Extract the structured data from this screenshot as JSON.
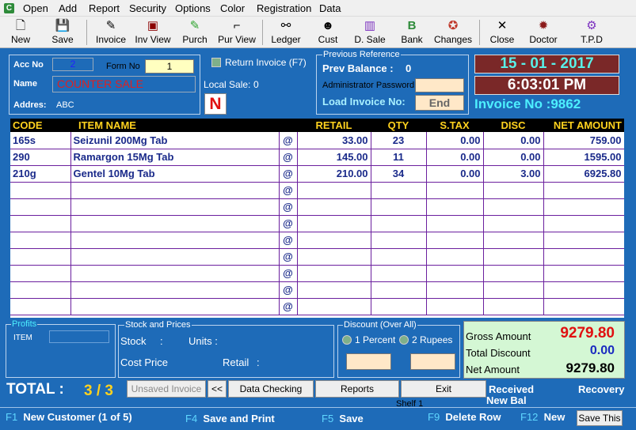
{
  "menu": [
    "Open",
    "Add",
    "Report",
    "Security",
    "Options",
    "Color",
    "Registration",
    "Data"
  ],
  "toolbar": [
    {
      "label": "New",
      "icon": "new-document-icon"
    },
    {
      "label": "Save",
      "icon": "save-icon"
    },
    {
      "label": "Invoice",
      "icon": "invoice-icon"
    },
    {
      "label": "Inv View",
      "icon": "invoice-view-icon"
    },
    {
      "label": "Purch",
      "icon": "purchase-icon"
    },
    {
      "label": "Pur View",
      "icon": "purchase-view-icon"
    },
    {
      "label": "Ledger",
      "icon": "ledger-icon"
    },
    {
      "label": "Cust",
      "icon": "customer-icon"
    },
    {
      "label": "D. Sale",
      "icon": "daily-sale-chart-icon"
    },
    {
      "label": "Bank",
      "icon": "bank-icon"
    },
    {
      "label": "Changes",
      "icon": "changes-icon"
    },
    {
      "label": "Close",
      "icon": "close-icon"
    },
    {
      "label": "Doctor",
      "icon": "doctor-icon"
    },
    {
      "label": "T.P.D",
      "icon": "tpd-icon"
    }
  ],
  "account": {
    "acc_no_label": "Acc No",
    "acc_no": "2",
    "form_no_label": "Form No",
    "form_no": "1",
    "name_label": "Name",
    "name": "COUNTER SALE",
    "address_label": "Addres:",
    "address": "ABC",
    "return_invoice": "Return Invoice (F7)",
    "local_sale_label": "Local Sale:",
    "local_sale": "0",
    "flag": "N"
  },
  "previous": {
    "title": "Previous Reference",
    "prev_balance_label": "Prev Balance :",
    "prev_balance": "0",
    "admin_pw_label": "Administrator Password",
    "load_invoice_label": "Load Invoice No:",
    "end_label": "End"
  },
  "datetime": {
    "date": "15 - 01 - 2017",
    "time": "6:03:01 PM",
    "invoice_no": "Invoice No :9862"
  },
  "grid": {
    "columns": [
      "CODE",
      "ITEM NAME",
      "",
      "RETAIL",
      "QTY",
      "S.TAX",
      "DISC",
      "NET AMOUNT"
    ],
    "rows": [
      {
        "code": "165s",
        "name": "Seizunil 200Mg Tab",
        "at": "@",
        "retail": "33.00",
        "qty": "23",
        "stax": "0.00",
        "disc": "0.00",
        "net": "759.00"
      },
      {
        "code": "290",
        "name": "Ramargon 15Mg Tab",
        "at": "@",
        "retail": "145.00",
        "qty": "11",
        "stax": "0.00",
        "disc": "0.00",
        "net": "1595.00"
      },
      {
        "code": "210g",
        "name": "Gentel 10Mg Tab",
        "at": "@",
        "retail": "210.00",
        "qty": "34",
        "stax": "0.00",
        "disc": "3.00",
        "net": "6925.80"
      },
      {
        "code": "",
        "name": "",
        "at": "@",
        "retail": "",
        "qty": "",
        "stax": "",
        "disc": "",
        "net": ""
      },
      {
        "code": "",
        "name": "",
        "at": "@",
        "retail": "",
        "qty": "",
        "stax": "",
        "disc": "",
        "net": ""
      },
      {
        "code": "",
        "name": "",
        "at": "@",
        "retail": "",
        "qty": "",
        "stax": "",
        "disc": "",
        "net": ""
      },
      {
        "code": "",
        "name": "",
        "at": "@",
        "retail": "",
        "qty": "",
        "stax": "",
        "disc": "",
        "net": ""
      },
      {
        "code": "",
        "name": "",
        "at": "@",
        "retail": "",
        "qty": "",
        "stax": "",
        "disc": "",
        "net": ""
      },
      {
        "code": "",
        "name": "",
        "at": "@",
        "retail": "",
        "qty": "",
        "stax": "",
        "disc": "",
        "net": ""
      },
      {
        "code": "",
        "name": "",
        "at": "@",
        "retail": "",
        "qty": "",
        "stax": "",
        "disc": "",
        "net": ""
      },
      {
        "code": "",
        "name": "",
        "at": "@",
        "retail": "",
        "qty": "",
        "stax": "",
        "disc": "",
        "net": ""
      }
    ]
  },
  "profits": {
    "title": "Profits",
    "item_label": "ITEM"
  },
  "stock": {
    "title": "Stock and Prices",
    "stock_label": "Stock",
    "stock_colon": ":",
    "units_label": "Units :",
    "cost_label": "Cost Price",
    "retail_label": "Retail",
    "retail_colon": ":"
  },
  "discount": {
    "title": "Discount  (Over All)",
    "percent_label": "1 Percent",
    "rupees_label": "2  Rupees"
  },
  "totals": {
    "gross_label": "Gross Amount",
    "gross": "9279.80",
    "discount_label": "Total Discount",
    "discount": "0.00",
    "net_label": "Net Amount",
    "net": "9279.80"
  },
  "footer": {
    "total_label": "TOTAL :",
    "total_count": "3 / 3",
    "unsaved": "Unsaved Invoice",
    "back": "<<",
    "data_checking": "Data Checking",
    "reports": "Reports",
    "exit": "Exit",
    "shelf": "Shelf 1",
    "received": "Received",
    "recovery": "Recovery",
    "new_bal": "New Bal"
  },
  "fkeys": [
    {
      "key": "F1",
      "text": "New Customer (1 of 5)"
    },
    {
      "key": "F4",
      "text": "Save and Print"
    },
    {
      "key": "F5",
      "text": "Save"
    },
    {
      "key": "F9",
      "text": "Delete Row"
    },
    {
      "key": "F12",
      "text": "New"
    }
  ],
  "save_this": "Save This",
  "colors": {
    "background": "#1e6bb8",
    "accent": "#ffd21e",
    "grid_border": "#6b1f9e",
    "date_panel": "#7a2828"
  }
}
